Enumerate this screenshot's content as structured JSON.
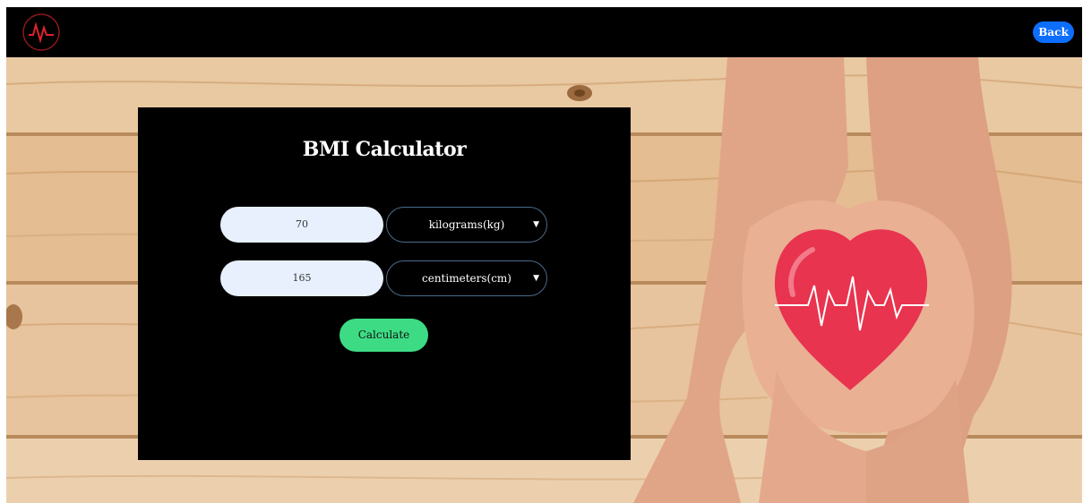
{
  "header": {
    "logo_icon": "heartbeat-logo-icon",
    "back_label": "Back"
  },
  "calculator": {
    "title": "BMI Calculator",
    "weight": {
      "value": "70",
      "unit": "kilograms(kg)"
    },
    "height": {
      "value": "165",
      "unit": "centimeters(cm)"
    },
    "calculate_label": "Calculate"
  },
  "colors": {
    "topbar": "#000000",
    "back_button": "#0d6efd",
    "calculate_button": "#3ddc84",
    "input_bg": "#e8f0fe",
    "heart": "#e8344e"
  }
}
